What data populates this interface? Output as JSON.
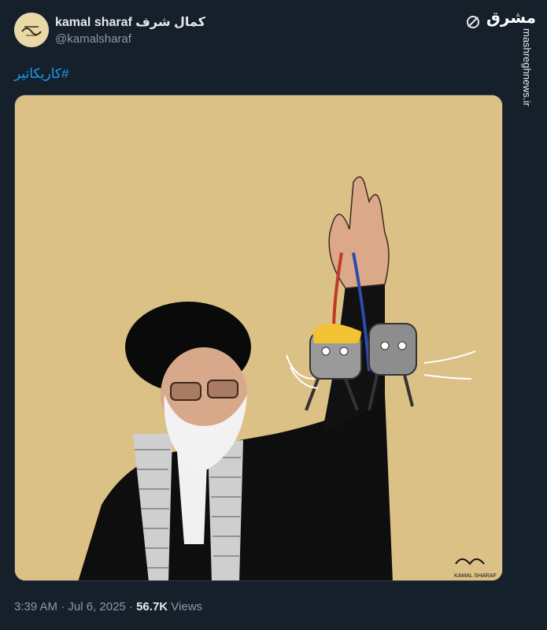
{
  "author": {
    "display_name": "kamal sharaf كمال شرف",
    "handle": "@kamalsharaf"
  },
  "post": {
    "text": "#کاریکاتیر"
  },
  "media": {
    "signature": "KAMAL SHARAF",
    "signature_ar": "كمال شرف"
  },
  "meta": {
    "time": "3:39 AM · Jul 6, 2025 · ",
    "views_count": "56.7K",
    "views_label": " Views"
  },
  "watermark": {
    "logo": "مشرق",
    "url": "mashreghnews.ir"
  },
  "icons": {
    "author_avatar": "avatar-logo",
    "x_logo": "x-logo-icon"
  },
  "colors": {
    "background": "#15202b",
    "link": "#1d9bf0",
    "media_background": "#dcc187"
  }
}
